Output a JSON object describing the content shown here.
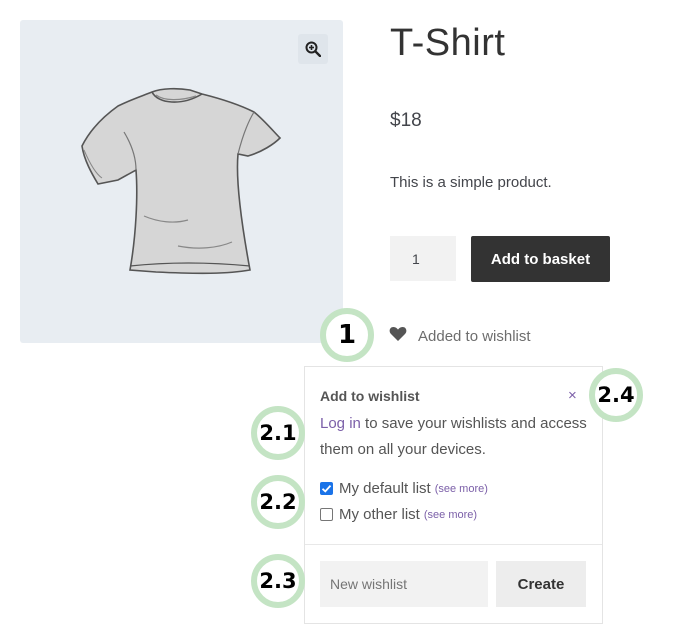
{
  "product": {
    "title": "T-Shirt",
    "price": "$18",
    "description": "This is a simple product.",
    "quantity": "1",
    "add_to_basket_label": "Add to basket",
    "zoom_icon": "magnify-plus-icon",
    "image_icon": "tshirt-image"
  },
  "wishlist_status": {
    "icon": "heart-icon",
    "text": "Added to wishlist"
  },
  "popup": {
    "title": "Add to wishlist",
    "close_label": "×",
    "login_link": "Log in",
    "login_text": " to save your wishlists and access them on all your devices.",
    "lists": [
      {
        "label": "My default list",
        "see_more": "(see more)",
        "checked": true
      },
      {
        "label": "My other list",
        "see_more": "(see more)",
        "checked": false
      }
    ],
    "new_list_placeholder": "New wishlist",
    "create_label": "Create"
  },
  "callouts": {
    "c1": "1",
    "c21": "2.1",
    "c22": "2.2",
    "c23": "2.3",
    "c24": "2.4"
  },
  "colors": {
    "accent_link": "#7b5fa8",
    "button_dark": "#333333",
    "callout_ring": "#c4e4c4",
    "checkbox_checked": "#1a73e8"
  }
}
